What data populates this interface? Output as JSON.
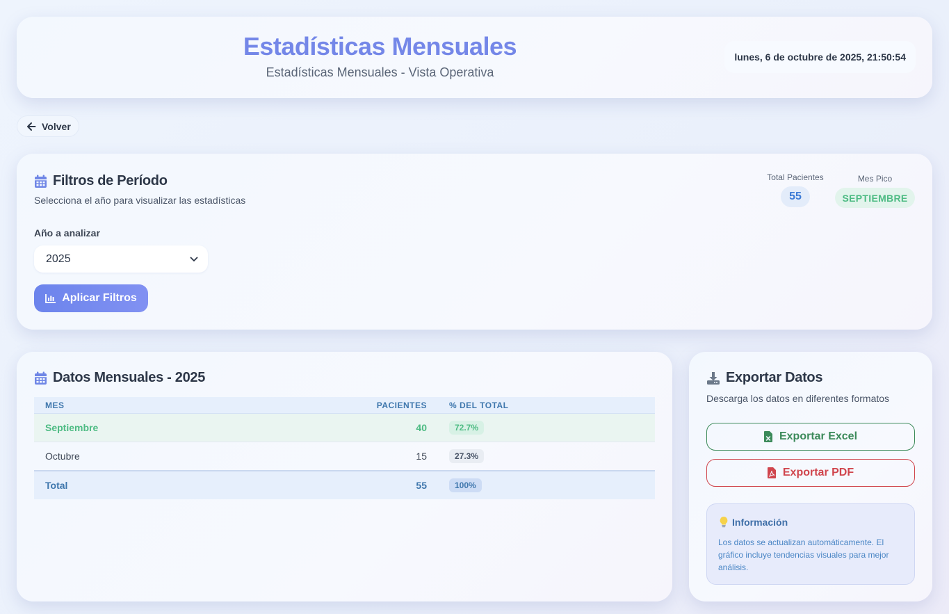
{
  "header": {
    "title": "Estadísticas Mensuales",
    "subtitle": "Estadísticas Mensuales - Vista Operativa",
    "datetime": "lunes, 6 de octubre de 2025, 21:50:54"
  },
  "nav": {
    "back_label": "Volver"
  },
  "filters": {
    "title": "Filtros de Período",
    "description": "Selecciona el año para visualizar las estadísticas",
    "year_label": "Año a analizar",
    "year_value": "2025",
    "apply_label": "Aplicar Filtros",
    "stats": {
      "total_patients_label": "Total Pacientes",
      "total_patients_value": "55",
      "peak_month_label": "Mes Pico",
      "peak_month_value": "SEPTIEMBRE"
    }
  },
  "monthly": {
    "title": "Datos Mensuales - 2025",
    "columns": [
      "MES",
      "PACIENTES",
      "% DEL TOTAL"
    ],
    "rows": [
      {
        "month": "Septiembre",
        "patients": "40",
        "percent": "72.7%"
      },
      {
        "month": "Octubre",
        "patients": "15",
        "percent": "27.3%"
      }
    ],
    "total": {
      "month": "Total",
      "patients": "55",
      "percent": "100%"
    }
  },
  "export": {
    "title": "Exportar Datos",
    "description": "Descarga los datos en diferentes formatos",
    "excel_label": "Exportar Excel",
    "pdf_label": "Exportar PDF",
    "info_title": "Información",
    "info_text": "Los datos se actualizan automáticamente. El gráfico incluye tendencias visuales para mejor análisis."
  },
  "icons": {
    "calendar": "calendar-icon",
    "arrow_left": "arrow-left-icon",
    "chart": "bar-chart-icon",
    "download": "download-icon",
    "excel": "file-excel-icon",
    "pdf": "file-pdf-icon",
    "lightbulb": "lightbulb-icon",
    "chevron": "chevron-down-icon"
  },
  "colors": {
    "accent": "#7487e8",
    "success": "#4dbb83",
    "info": "#3f77ad",
    "excel": "#3c8a5a",
    "pdf": "#d0454d"
  }
}
